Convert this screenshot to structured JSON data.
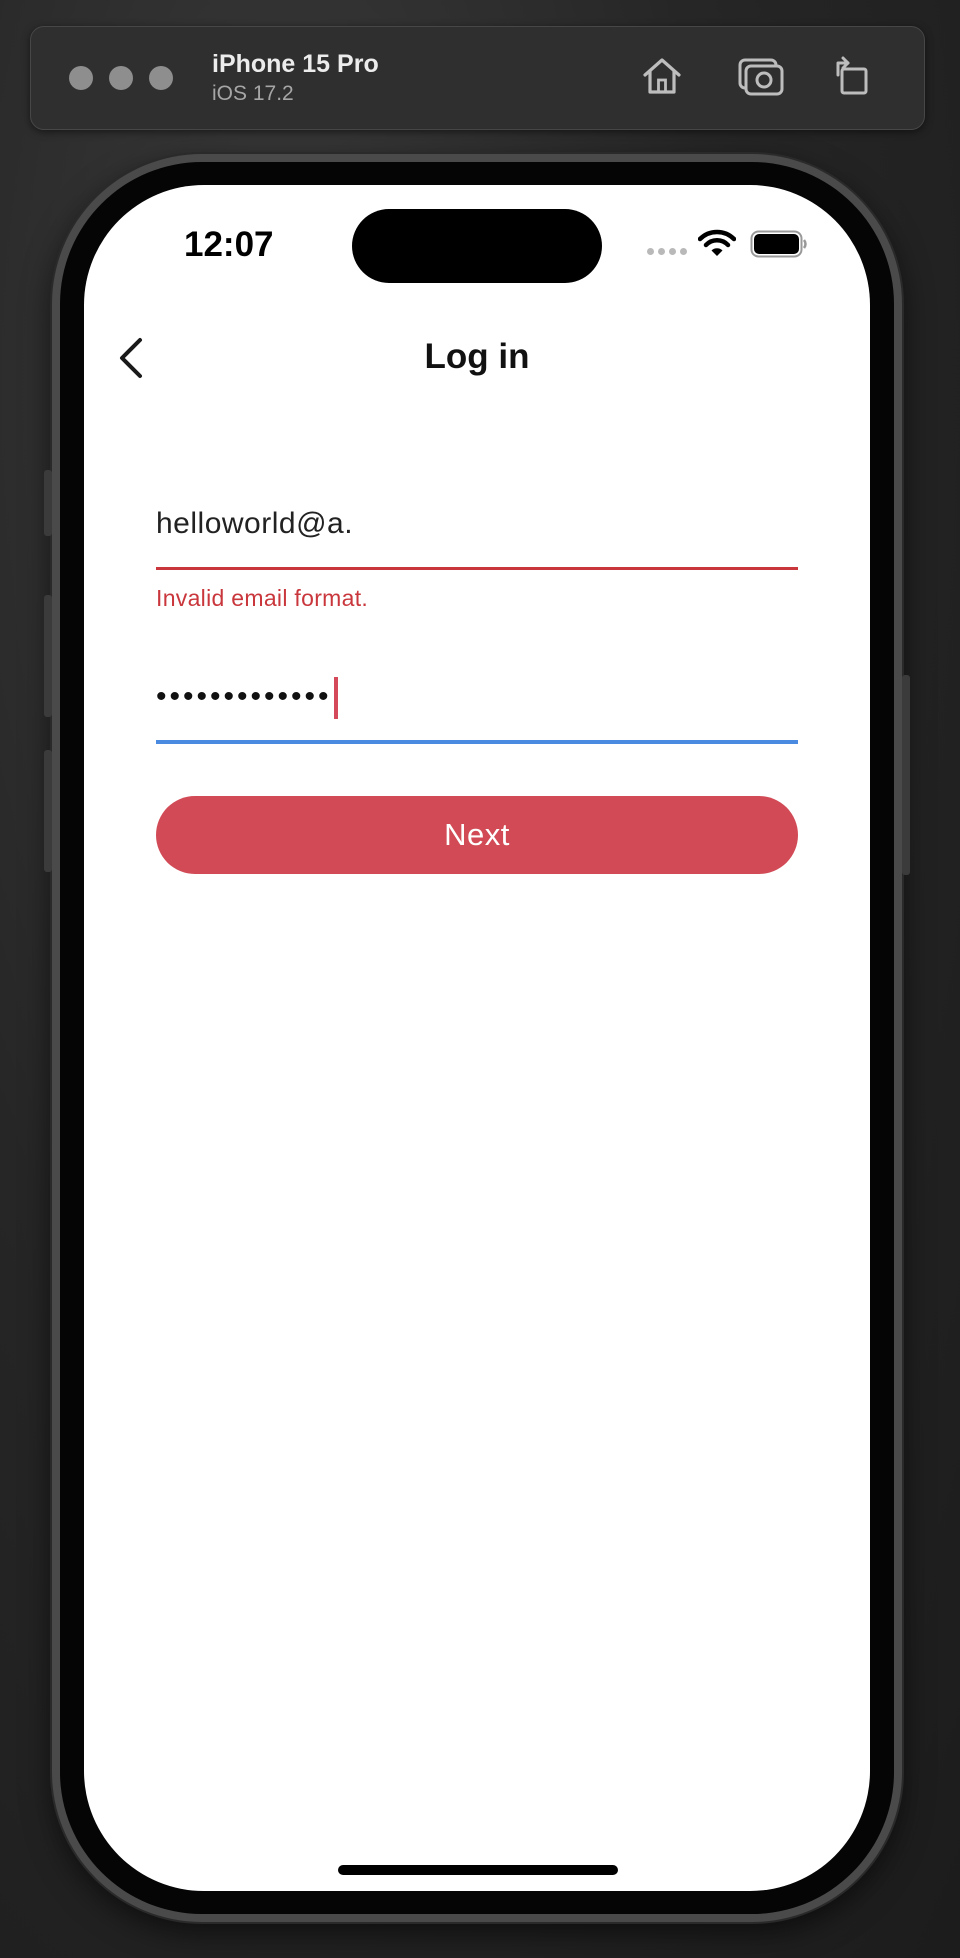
{
  "simulator": {
    "device_name": "iPhone 15 Pro",
    "os_version": "iOS 17.2",
    "toolbar_icons": [
      "home-icon",
      "screenshot-icon",
      "rotate-icon"
    ]
  },
  "status_bar": {
    "time": "12:07",
    "icons": [
      "cellular-dots-icon",
      "wifi-icon",
      "battery-icon"
    ]
  },
  "nav": {
    "title": "Log in",
    "back_icon": "chevron-left-icon"
  },
  "form": {
    "email_value": "helloworld@a.",
    "email_error": "Invalid email format.",
    "password_value": "•••••••••••••",
    "next_label": "Next"
  },
  "colors": {
    "error": "#c9373c",
    "focus": "#4a8ae0",
    "primary_button": "#d14a55"
  }
}
